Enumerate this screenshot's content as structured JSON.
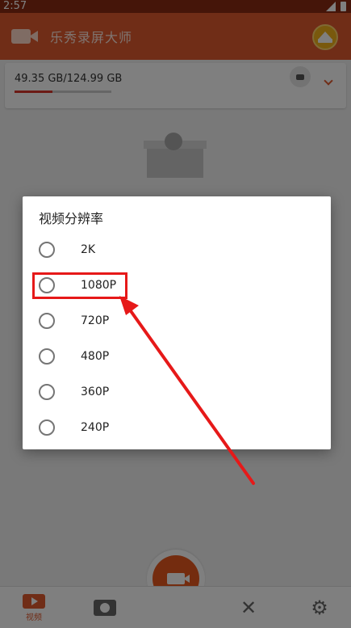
{
  "status_bar": {
    "time": "2:57"
  },
  "app_bar": {
    "title": "乐秀录屏大师"
  },
  "storage": {
    "text": "49.35 GB/124.99 GB",
    "used_fraction": 0.395
  },
  "nav": {
    "video_label": "视频"
  },
  "dialog": {
    "title": "视频分辨率",
    "options": [
      {
        "label": "2K",
        "selected": false
      },
      {
        "label": "1080P",
        "selected": false
      },
      {
        "label": "720P",
        "selected": false
      },
      {
        "label": "480P",
        "selected": false
      },
      {
        "label": "360P",
        "selected": false
      },
      {
        "label": "240P",
        "selected": false
      }
    ]
  },
  "colors": {
    "accent": "#e05a2e",
    "annotation": "#e61919"
  }
}
